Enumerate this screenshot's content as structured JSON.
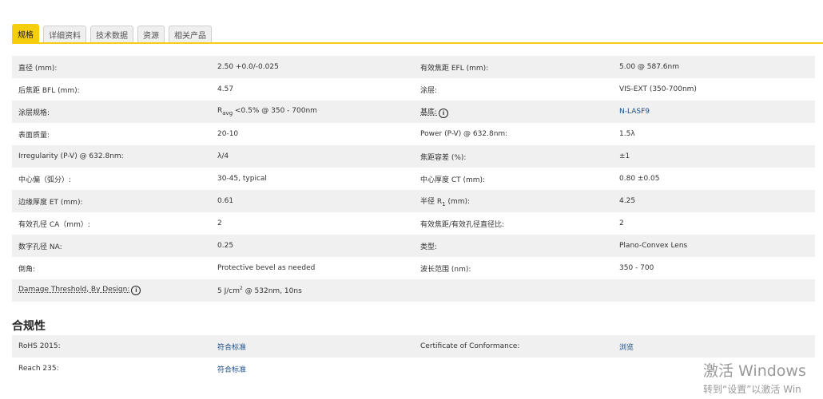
{
  "tabs": [
    {
      "label": "规格",
      "active": true
    },
    {
      "label": "详细资料",
      "active": false
    },
    {
      "label": "技术数据",
      "active": false
    },
    {
      "label": "资源",
      "active": false
    },
    {
      "label": "相关产品",
      "active": false
    }
  ],
  "specs": {
    "r0": {
      "l1": "直径 (mm):",
      "v1": "2.50 +0.0/-0.025",
      "l2": "有效焦距 EFL (mm):",
      "v2": "5.00 @ 587.6nm"
    },
    "r1": {
      "l1": "后焦距 BFL (mm):",
      "v1": "4.57",
      "l2": "涂层:",
      "v2": "VIS-EXT (350-700nm)"
    },
    "r2": {
      "l1": "涂层规格:",
      "v1_pre": "R",
      "v1_sub": "avg",
      "v1_post": " <0.5% @ 350 - 700nm",
      "l2": "基底:",
      "v2": "N-LASF9"
    },
    "r3": {
      "l1": "表面质量:",
      "v1": "20-10",
      "l2": "Power (P-V) @ 632.8nm:",
      "v2": "1.5λ"
    },
    "r4": {
      "l1": "Irregularity (P-V) @ 632.8nm:",
      "v1": "λ/4",
      "l2": "焦距容差 (%):",
      "v2": "±1"
    },
    "r5": {
      "l1": "中心偏（弧分）:",
      "v1": "30-45, typical",
      "l2": "中心厚度 CT (mm):",
      "v2": "0.80 ±0.05"
    },
    "r6": {
      "l1": "边缘厚度 ET (mm):",
      "v1": "0.61",
      "l2_pre": "半径 R",
      "l2_sub": "1",
      "l2_post": " (mm):",
      "v2": "4.25"
    },
    "r7": {
      "l1": "有效孔径 CA（mm）:",
      "v1": "2",
      "l2": "有效焦距/有效孔径直径比:",
      "v2": "2"
    },
    "r8": {
      "l1": "数字孔径 NA:",
      "v1": "0.25",
      "l2": "类型:",
      "v2": "Plano-Convex Lens"
    },
    "r9": {
      "l1": "倒角:",
      "v1": "Protective bevel as needed",
      "l2": "波长范围 (nm):",
      "v2": "350 - 700"
    },
    "r10": {
      "l1": "Damage Threshold, By Design:",
      "v1_pre": "5 J/cm",
      "v1_sup": "2",
      "v1_post": " @ 532nm, 10ns"
    }
  },
  "compliance": {
    "title": "合规性",
    "r0": {
      "l1": "RoHS 2015:",
      "v1": "符合标准",
      "l2": "Certificate of Conformance:",
      "v2": "浏览"
    },
    "r1": {
      "l1": "Reach 235:",
      "v1": "符合标准"
    }
  },
  "watermark": {
    "title": "激活 Windows",
    "subtitle": "转到“设置”以激活 Win"
  },
  "info_icon_glyph": "i",
  "colors": {
    "accent": "#f5cf0d",
    "link": "#1a4f8a",
    "row_alt": "#f0f0f0"
  }
}
